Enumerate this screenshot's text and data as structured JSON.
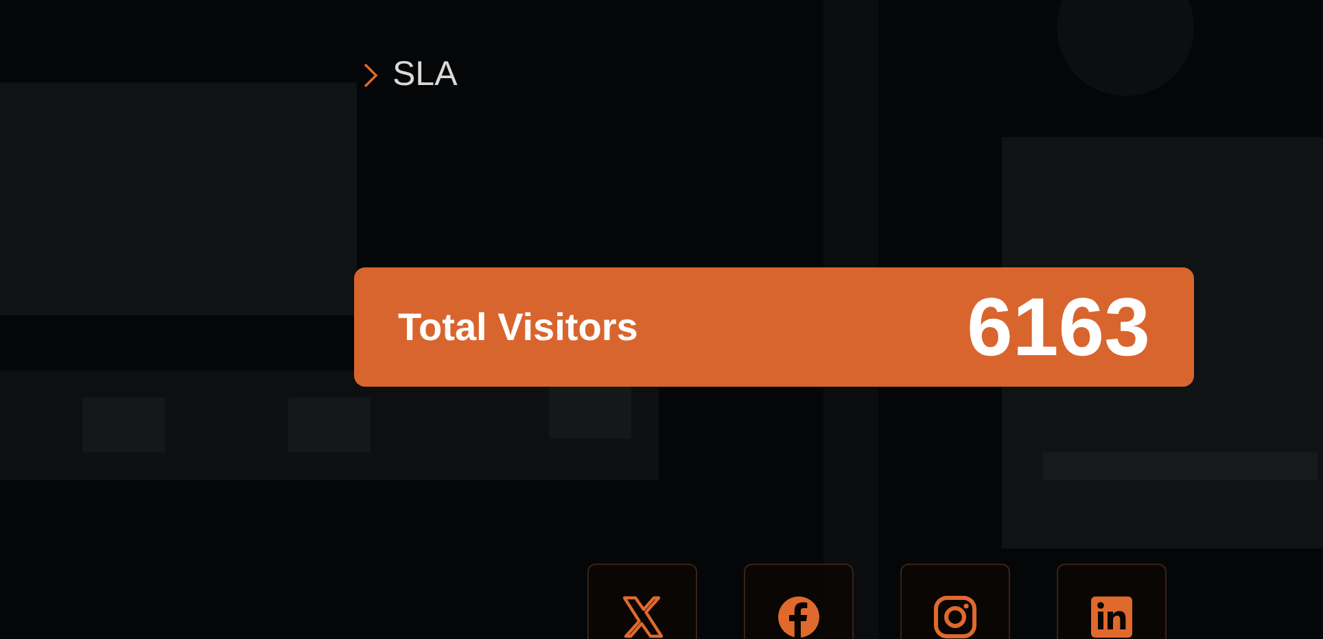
{
  "links": [
    {
      "label": "SLA"
    }
  ],
  "visitors": {
    "label": "Total Visitors",
    "count": "6163"
  },
  "social": [
    {
      "kind": "x"
    },
    {
      "kind": "facebook"
    },
    {
      "kind": "instagram"
    },
    {
      "kind": "linkedin"
    }
  ]
}
